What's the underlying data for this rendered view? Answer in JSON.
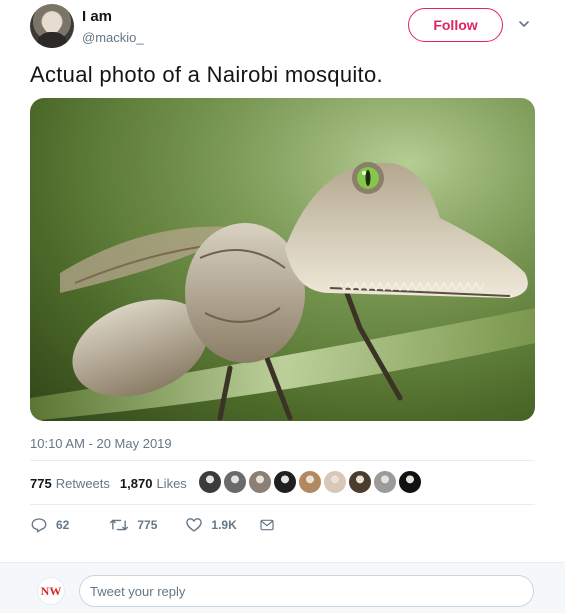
{
  "author": {
    "display_name": "I am",
    "handle": "@mackio_"
  },
  "follow_label": "Follow",
  "tweet_text": "Actual photo of a Nairobi mosquito.",
  "timestamp": "10:10 AM - 20 May 2019",
  "stats": {
    "retweets_count": "775",
    "retweets_label": "Retweets",
    "likes_count": "1,870",
    "likes_label": "Likes"
  },
  "actions": {
    "reply_count": "62",
    "retweet_count": "775",
    "like_count": "1.9K"
  },
  "reply_box": {
    "avatar_text": "NW",
    "placeholder": "Tweet your reply"
  },
  "colors": {
    "accent": "#e0245e",
    "secondary_text": "#657786",
    "reply_avatar": "#d62b2b"
  },
  "liker_avatar_colors": [
    "#3b3b3b",
    "#6a6a6a",
    "#8c7f73",
    "#1f1f1f",
    "#b08a5e",
    "#d9c7b8",
    "#4a3d2e",
    "#9b9b9b",
    "#111111"
  ],
  "icons": [
    "chevron-down-icon",
    "reply-icon",
    "retweet-icon",
    "heart-icon",
    "dm-icon"
  ]
}
